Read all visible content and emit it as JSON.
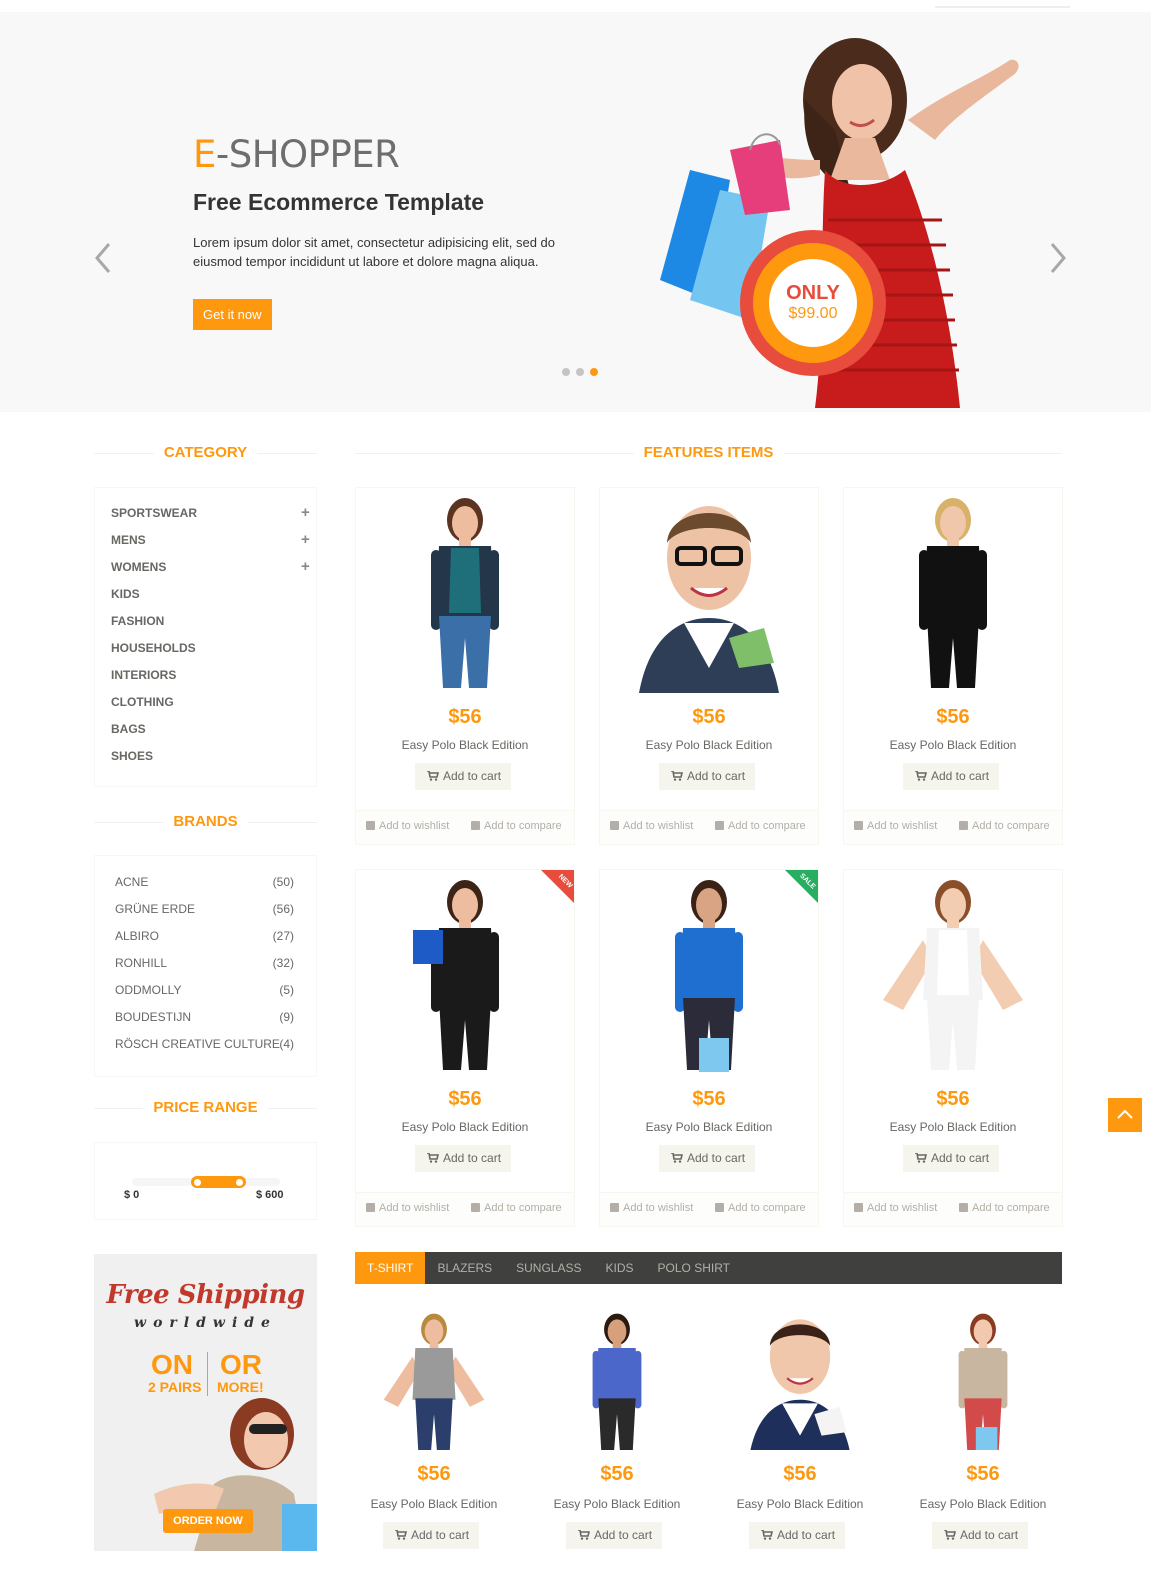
{
  "hero": {
    "brand_first": "E",
    "brand_rest": "-SHOPPER",
    "headline": "Free Ecommerce Template",
    "body": "Lorem ipsum dolor sit amet, consectetur adipisicing elit, sed do eiusmod tempor incididunt ut labore et dolore magna aliqua.",
    "cta": "Get it now",
    "badge_title": "ONLY",
    "badge_price": "$99.00",
    "active_slide": 3,
    "slide_count": 3
  },
  "sidebar": {
    "category_title": "CATEGORY",
    "categories": [
      {
        "label": "SPORTSWEAR",
        "expandable": true
      },
      {
        "label": "MENS",
        "expandable": true
      },
      {
        "label": "WOMENS",
        "expandable": true
      },
      {
        "label": "KIDS",
        "expandable": false
      },
      {
        "label": "FASHION",
        "expandable": false
      },
      {
        "label": "HOUSEHOLDS",
        "expandable": false
      },
      {
        "label": "INTERIORS",
        "expandable": false
      },
      {
        "label": "CLOTHING",
        "expandable": false
      },
      {
        "label": "BAGS",
        "expandable": false
      },
      {
        "label": "SHOES",
        "expandable": false
      }
    ],
    "expand_symbol": "+",
    "brands_title": "BRANDS",
    "brands": [
      {
        "name": "ACNE",
        "count": "(50)"
      },
      {
        "name": "GRÜNE ERDE",
        "count": "(56)"
      },
      {
        "name": "ALBIRO",
        "count": "(27)"
      },
      {
        "name": "RONHILL",
        "count": "(32)"
      },
      {
        "name": "ODDMOLLY",
        "count": "(5)"
      },
      {
        "name": "BOUDESTIJN",
        "count": "(9)"
      },
      {
        "name": "RÖSCH CREATIVE CULTURE",
        "count": "(4)"
      }
    ],
    "price_title": "PRICE RANGE",
    "price_min": "$ 0",
    "price_max": "$ 600",
    "price_selection": [
      0.42,
      0.75
    ]
  },
  "promo": {
    "line1": "Free Shipping",
    "line2": "worldwide",
    "left_big": "ON",
    "left_small": "2 PAIRS",
    "right_big": "OR",
    "right_small": "MORE!",
    "button": "ORDER NOW"
  },
  "features": {
    "title": "FEATURES ITEMS",
    "items": [
      {
        "price": "$56",
        "name": "Easy Polo Black Edition",
        "cart": "Add to cart",
        "wishlist": "Add to wishlist",
        "compare": "Add to compare",
        "ribbon": ""
      },
      {
        "price": "$56",
        "name": "Easy Polo Black Edition",
        "cart": "Add to cart",
        "wishlist": "Add to wishlist",
        "compare": "Add to compare",
        "ribbon": ""
      },
      {
        "price": "$56",
        "name": "Easy Polo Black Edition",
        "cart": "Add to cart",
        "wishlist": "Add to wishlist",
        "compare": "Add to compare",
        "ribbon": ""
      },
      {
        "price": "$56",
        "name": "Easy Polo Black Edition",
        "cart": "Add to cart",
        "wishlist": "Add to wishlist",
        "compare": "Add to compare",
        "ribbon": "NEW"
      },
      {
        "price": "$56",
        "name": "Easy Polo Black Edition",
        "cart": "Add to cart",
        "wishlist": "Add to wishlist",
        "compare": "Add to compare",
        "ribbon": "SALE"
      },
      {
        "price": "$56",
        "name": "Easy Polo Black Edition",
        "cart": "Add to cart",
        "wishlist": "Add to wishlist",
        "compare": "Add to compare",
        "ribbon": ""
      }
    ]
  },
  "tabs": {
    "labels": [
      "T-SHIRT",
      "BLAZERS",
      "SUNGLASS",
      "KIDS",
      "POLO SHIRT"
    ],
    "active": 0,
    "items": [
      {
        "price": "$56",
        "name": "Easy Polo Black Edition",
        "cart": "Add to cart"
      },
      {
        "price": "$56",
        "name": "Easy Polo Black Edition",
        "cart": "Add to cart"
      },
      {
        "price": "$56",
        "name": "Easy Polo Black Edition",
        "cart": "Add to cart"
      },
      {
        "price": "$56",
        "name": "Easy Polo Black Edition",
        "cart": "Add to cart"
      }
    ]
  },
  "colors": {
    "accent": "#fe980f",
    "text": "#696763",
    "dark": "#363432",
    "tabbar": "#40403e",
    "ribbon_new": "#e74c3c",
    "ribbon_sale": "#27ae60"
  },
  "icons": {
    "slider_prev": "chevron-left-icon",
    "slider_next": "chevron-right-icon",
    "cart": "shopping-cart-icon",
    "wishlist": "plus-square-icon",
    "compare": "plus-square-icon",
    "scroll_top": "chevron-up-icon"
  }
}
